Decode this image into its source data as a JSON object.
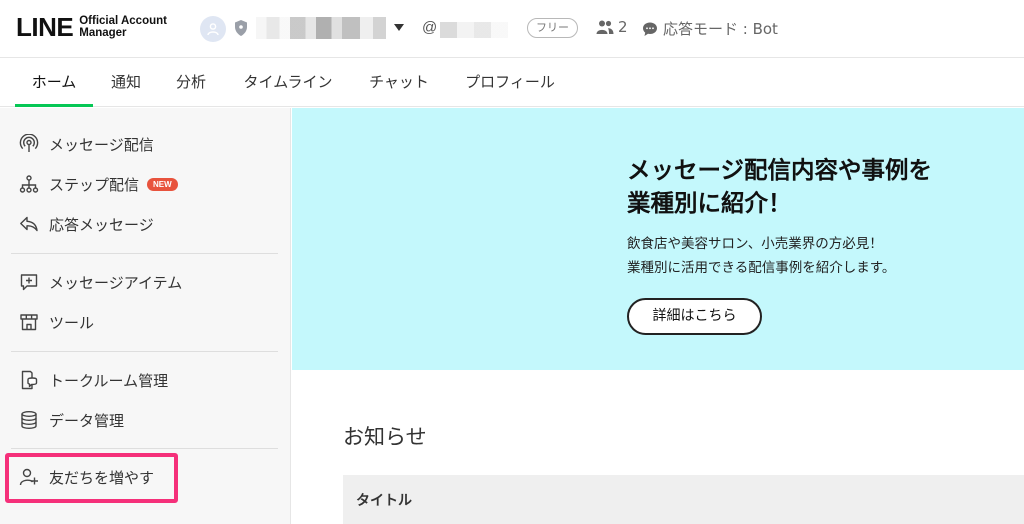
{
  "header": {
    "brand": "LINE",
    "brand_sub_line1": "Official Account",
    "brand_sub_line2": "Manager",
    "at_symbol": "@",
    "plan_badge": "フリー",
    "member_count": "2",
    "response_mode": "応答モード : Bot"
  },
  "tabs": [
    {
      "label": "ホーム"
    },
    {
      "label": "通知"
    },
    {
      "label": "分析"
    },
    {
      "label": "タイムライン"
    },
    {
      "label": "チャット"
    },
    {
      "label": "プロフィール"
    }
  ],
  "sidebar": {
    "items": [
      {
        "label": "メッセージ配信",
        "icon": "broadcast-icon"
      },
      {
        "label": "ステップ配信",
        "icon": "step-tree-icon",
        "badge": "NEW"
      },
      {
        "label": "応答メッセージ",
        "icon": "reply-arrow-icon"
      },
      {
        "label": "メッセージアイテム",
        "icon": "message-item-icon"
      },
      {
        "label": "ツール",
        "icon": "tool-shop-icon"
      },
      {
        "label": "トークルーム管理",
        "icon": "chat-room-icon"
      },
      {
        "label": "データ管理",
        "icon": "database-icon"
      },
      {
        "label": "友だちを増やす",
        "icon": "add-friend-icon"
      }
    ]
  },
  "banner": {
    "title_line1": "メッセージ配信内容や事例を",
    "title_line2": "業種別に紹介！",
    "text_line1": "飲食店や美容サロン、小売業界の方必見！",
    "text_line2": "業種別に活用できる配信事例を紹介します。",
    "button": "詳細はこちら"
  },
  "notices": {
    "title": "お知らせ",
    "column_title": "タイトル"
  },
  "colors": {
    "accent_green": "#06c755",
    "banner_bg": "#c4f8fc",
    "highlight": "#f5307a",
    "new_badge": "#e8533d"
  }
}
